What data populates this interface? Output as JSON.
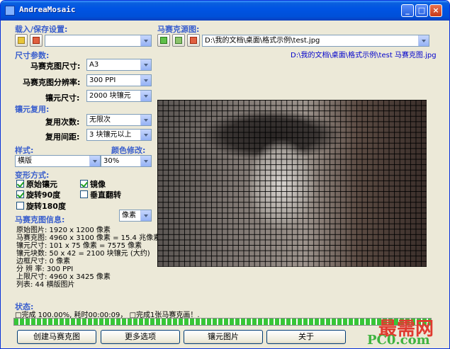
{
  "window": {
    "title": "AndreaMosaic"
  },
  "load_save": {
    "label": "载入/保存设置:",
    "combo_value": ""
  },
  "source": {
    "label": "马赛克源图:",
    "path": "D:\\我的文档\\桌面\\格式示例\\test.jpg",
    "output_path": "D:\\我的文档\\桌面\\格式示例\\test 马赛克图.jpg"
  },
  "size_params": {
    "label": "尺寸参数:",
    "mosaic_size_label": "马赛克图尺寸:",
    "mosaic_size_value": "A3",
    "resolution_label": "马赛克图分辨率:",
    "resolution_value": "300 PPI",
    "tile_size_label": "镶元尺寸:",
    "tile_size_value": "2000 块镶元"
  },
  "reuse": {
    "label": "镶元复用:",
    "count_label": "复用次数:",
    "count_value": "无限次",
    "distance_label": "复用间距:",
    "distance_value": "3 块镶元以上"
  },
  "style": {
    "label": "样式:",
    "value": "横版",
    "color_label": "颜色修改:",
    "color_value": "30%"
  },
  "transform": {
    "label": "变形方式:",
    "original": "原始镶元",
    "mirror": "镜像",
    "rotate90": "旋转90度",
    "vflip": "垂直翻转",
    "rotate180": "旋转180度"
  },
  "info": {
    "label": "马赛克图信息:",
    "unit_value": "像素",
    "lines": [
      "原始图片:  1920 x 1200 像素",
      "马赛克图:  4960 x 3100 像素 = 15.4 兆像素",
      "镶元尺寸:  101 x 75 像素 = 7575 像素",
      "镶元块数:  50 x 42 = 2100 块镶元 (大约)",
      "边框尺寸:  0 像素",
      "分 辨 率:  300 PPI",
      "上限尺寸:  4960 x 3425 像素",
      "列表:  44 横版图片"
    ]
  },
  "status": {
    "label": "状态:",
    "text": "□完成 100.00%, 耗时00:00:09，  □完成1张马赛克画！.",
    "progress": 100
  },
  "buttons": {
    "create": "创建马赛克图",
    "more": "更多选项",
    "tiles": "镶元图片",
    "about": "关于"
  },
  "watermark": {
    "line1": "最需网",
    "line2": "PC0.com"
  }
}
